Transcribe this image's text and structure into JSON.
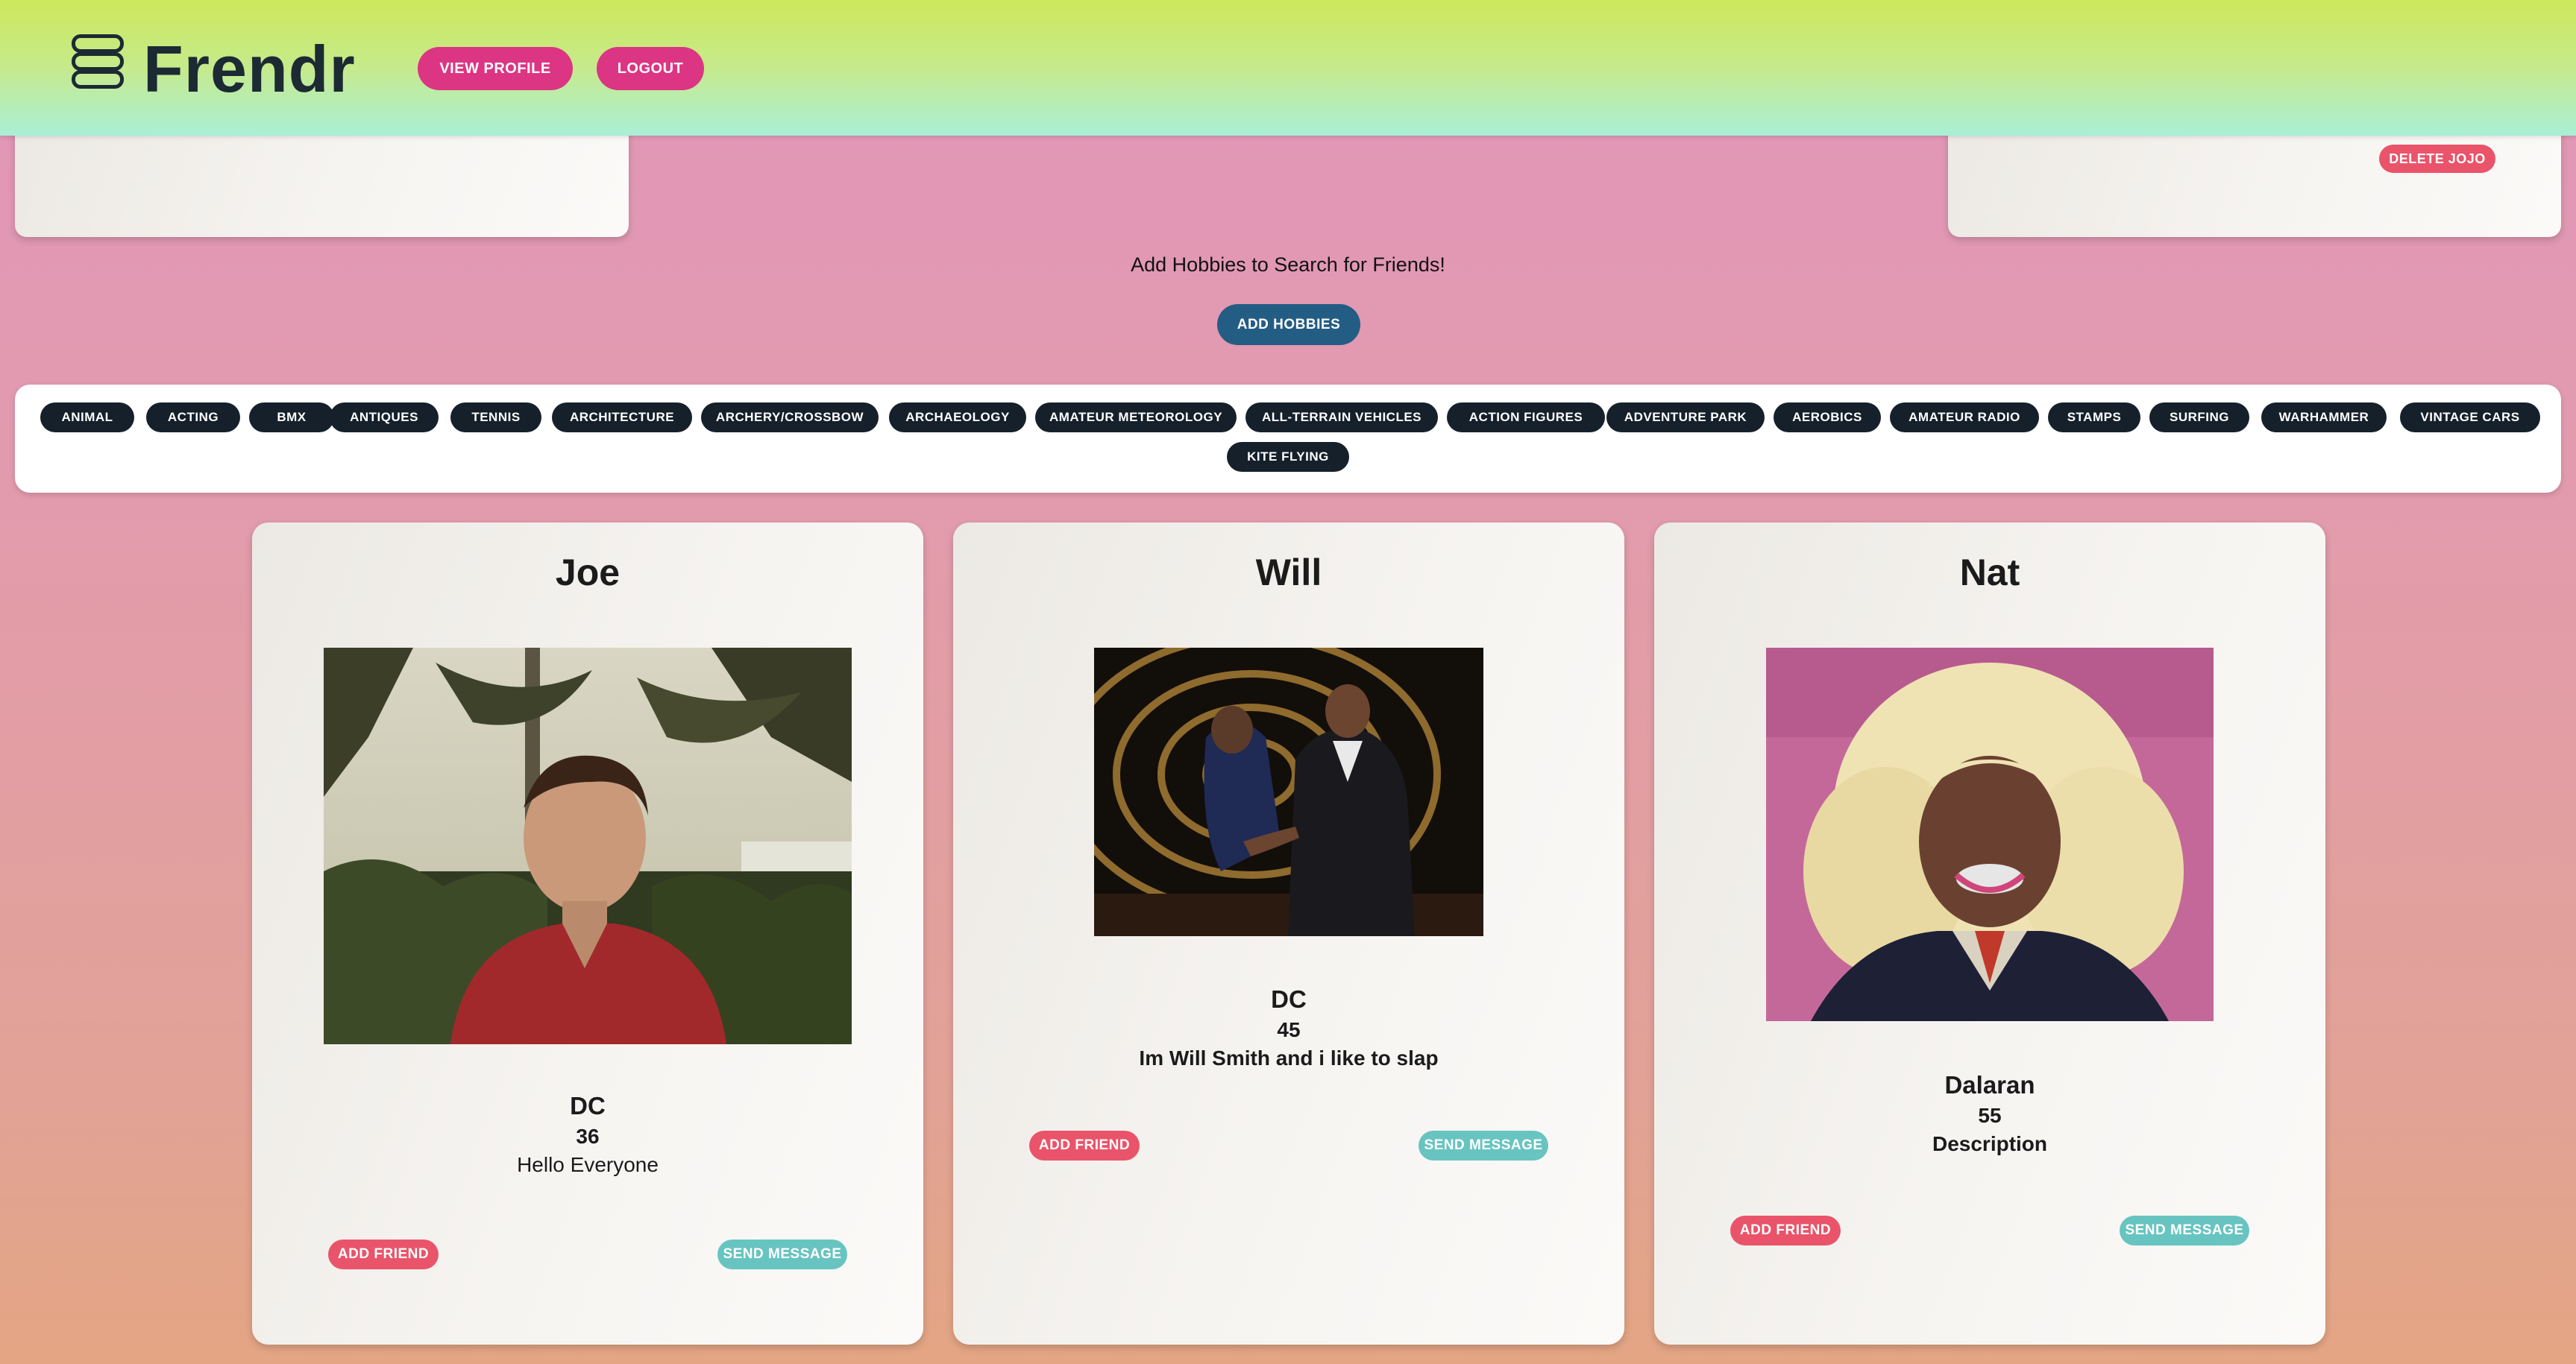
{
  "header": {
    "brand": "Frendr",
    "logo_icon": "stack-icon",
    "view_profile": "VIEW PROFILE",
    "logout": "LOGOUT",
    "gradient": [
      "#cde85b",
      "#a9efd6"
    ]
  },
  "top_cards": {
    "delete_label": "DELETE JOJO"
  },
  "search": {
    "prompt": "Add Hobbies to Search for Friends!",
    "add_hobbies": "ADD HOBBIES"
  },
  "hobbies": [
    "ANIMAL",
    "ACTING",
    "BMX",
    "ANTIQUES",
    "TENNIS",
    "ARCHITECTURE",
    "ARCHERY/CROSSBOW",
    "ARCHAEOLOGY",
    "AMATEUR METEOROLOGY",
    "ALL-TERRAIN VEHICLES",
    "ACTION FIGURES",
    "ADVENTURE PARK",
    "AEROBICS",
    "AMATEUR RADIO",
    "STAMPS",
    "SURFING",
    "WARHAMMER",
    "VINTAGE CARS",
    "KITE FLYING"
  ],
  "users": [
    {
      "name": "Joe",
      "location": "DC",
      "age": "36",
      "description": "Hello Everyone",
      "add_friend": "ADD FRIEND",
      "send_message": "SEND MESSAGE"
    },
    {
      "name": "Will",
      "location": "DC",
      "age": "45",
      "description": "Im Will Smith and i like to slap",
      "add_friend": "ADD FRIEND",
      "send_message": "SEND MESSAGE"
    },
    {
      "name": "Nat",
      "location": "Dalaran",
      "age": "55",
      "description": "Description",
      "add_friend": "ADD FRIEND",
      "send_message": "SEND MESSAGE"
    }
  ],
  "colors": {
    "primary_button": "#dc3583",
    "delete_button": "#e9546a",
    "add_friend": "#e9546a",
    "send_message": "#68c4c0",
    "add_hobbies": "#235d84",
    "chip": "#15202b"
  }
}
